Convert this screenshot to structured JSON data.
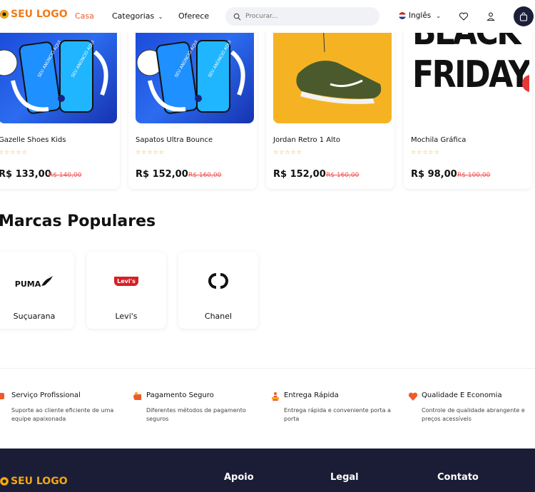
{
  "header": {
    "logo_text": "SEU LOGO",
    "nav": [
      "Casa",
      "Categorias",
      "Oferece"
    ],
    "search_placeholder": "Procurar...",
    "language": "Inglês"
  },
  "products": [
    {
      "name": "Gazelle Shoes Kids",
      "price": "R$ 133,00",
      "old_price": "R$ 140,00",
      "rating": 0,
      "image": "phone-ad",
      "ad_text": "SEU ANÚNCIO AQUI"
    },
    {
      "name": "Sapatos Ultra Bounce",
      "price": "R$ 152,00",
      "old_price": "R$ 160,00",
      "rating": 0,
      "image": "phone-ad",
      "ad_text": "SEU ANÚNCIO AQUI"
    },
    {
      "name": "Jordan Retro 1 Alto",
      "price": "R$ 152,00",
      "old_price": "R$ 160,00",
      "rating": 0,
      "image": "sneaker"
    },
    {
      "name": "Mochila Gráfica",
      "price": "R$ 98,00",
      "old_price": "R$ 100,00",
      "rating": 0,
      "image": "black-friday",
      "banner_text": [
        "BLACK",
        "FRIDAY"
      ]
    }
  ],
  "brands_section": {
    "title": "Marcas Populares",
    "brands": [
      {
        "name": "Suçuarana",
        "logo": "PUMA"
      },
      {
        "name": "Levi's",
        "logo": "Levi's"
      },
      {
        "name": "Chanel",
        "logo": "chanel-cc"
      }
    ]
  },
  "features": [
    {
      "title": "Serviço Profissional",
      "desc": "Suporte ao cliente eficiente de uma equipe apaixonada",
      "icon": "headset-icon"
    },
    {
      "title": "Pagamento Seguro",
      "desc": "Diferentes métodos de pagamento seguros",
      "icon": "payment-icon"
    },
    {
      "title": "Entrega Rápida",
      "desc": "Entrega rápida e conveniente porta a porta",
      "icon": "delivery-icon"
    },
    {
      "title": "Qualidade E Economia",
      "desc": "Controle de qualidade abrangente e preços acessíveis",
      "icon": "heart-icon"
    }
  ],
  "footer": {
    "logo_text": "SEU LOGO",
    "columns": [
      "Apoio",
      "Legal",
      "Contato"
    ]
  },
  "colors": {
    "accent": "#f05a28",
    "logo": "#f07b1a",
    "footer_bg": "#1b1d36",
    "star": "#f3a712",
    "old_price": "#f05252"
  }
}
